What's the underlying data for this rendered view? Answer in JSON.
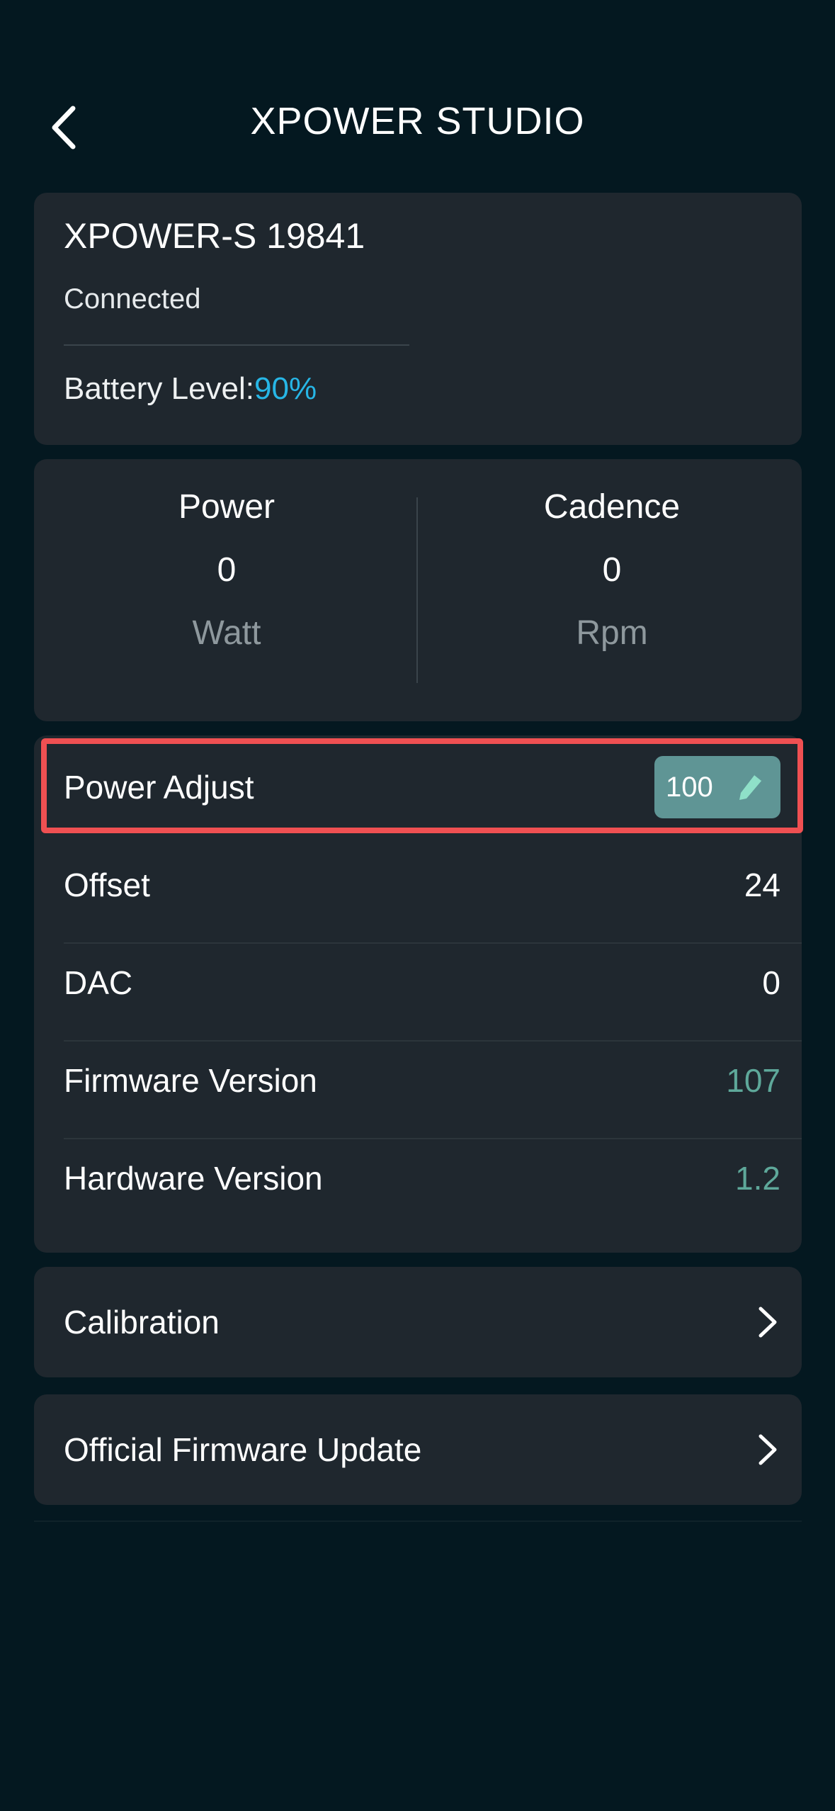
{
  "header": {
    "title": "XPOWER STUDIO",
    "back_icon": "chevron-left-icon"
  },
  "device": {
    "name": "XPOWER-S 19841",
    "status": "Connected",
    "battery_label": "Battery Level:",
    "battery_value": "90%"
  },
  "metrics": {
    "power": {
      "label": "Power",
      "value": "0",
      "unit": "Watt"
    },
    "cadence": {
      "label": "Cadence",
      "value": "0",
      "unit": "Rpm"
    }
  },
  "settings": {
    "power_adjust": {
      "label": "Power Adjust",
      "value": "100",
      "icon": "pencil-icon"
    },
    "offset": {
      "label": "Offset",
      "value": "24"
    },
    "dac": {
      "label": "DAC",
      "value": "0"
    },
    "firmware": {
      "label": "Firmware Version",
      "value": "107"
    },
    "hardware": {
      "label": "Hardware Version",
      "value": "1.2"
    }
  },
  "nav": {
    "calibration": {
      "label": "Calibration",
      "icon": "chevron-right-icon"
    },
    "firmware_update": {
      "label": "Official Firmware Update",
      "icon": "chevron-right-icon"
    }
  },
  "colors": {
    "background": "#041820",
    "card": "#1f272e",
    "accent_blue": "#27b6e6",
    "accent_teal": "#5ea89a",
    "highlight": "#ef5052"
  }
}
